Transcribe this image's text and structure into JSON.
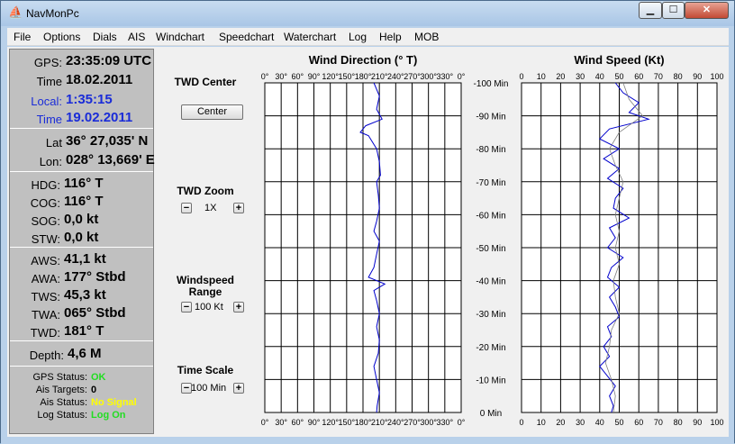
{
  "window": {
    "title": "NavMonPc",
    "app_icon": "⛵",
    "min_label": "▁",
    "max_label": "☐",
    "close_label": "✕"
  },
  "menu": [
    "File",
    "Options",
    "Dials",
    "AIS",
    "Windchart",
    "Speedchart",
    "Waterchart",
    "Log",
    "Help",
    "MOB"
  ],
  "instruments": {
    "time": [
      {
        "label": "GPS:",
        "value": "23:35:09 UTC"
      },
      {
        "label": "Time",
        "value": "18.02.2011"
      },
      {
        "label": "Local:",
        "value": "1:35:15"
      },
      {
        "label": "Time",
        "value": "19.02.2011"
      }
    ],
    "position": [
      {
        "label": "Lat",
        "value": "36° 27,035' N"
      },
      {
        "label": "Lon:",
        "value": "028° 13,669' E"
      }
    ],
    "heading": [
      {
        "label": "HDG:",
        "value": "116° T"
      },
      {
        "label": "COG:",
        "value": "116° T"
      },
      {
        "label": "SOG:",
        "value": "0,0 kt"
      },
      {
        "label": "STW:",
        "value": "0,0 kt"
      }
    ],
    "wind": [
      {
        "label": "AWS:",
        "value": "41,1 kt"
      },
      {
        "label": "AWA:",
        "value": "177° Stbd"
      },
      {
        "label": "TWS:",
        "value": "45,3 kt"
      },
      {
        "label": "TWA:",
        "value": "065° Stbd"
      },
      {
        "label": "TWD:",
        "value": "181° T"
      }
    ],
    "depth": {
      "label": "Depth:",
      "value": "4,6 M"
    },
    "status": [
      {
        "label": "GPS Status:",
        "value": "OK",
        "color": "#22dd22"
      },
      {
        "label": "Ais Targets:",
        "value": "0",
        "color": "#000000"
      },
      {
        "label": "Ais Status:",
        "value": "No Signal",
        "color": "#ffff00"
      },
      {
        "label": "Log Status:",
        "value": "Log On",
        "color": "#22dd22"
      }
    ]
  },
  "controls": {
    "twd_center_label": "TWD Center",
    "center_button": "Center",
    "twd_zoom_label": "TWD Zoom",
    "twd_zoom_value": "1X",
    "windspeed_range_label": "Windspeed Range",
    "windspeed_range_value": "100 Kt",
    "time_scale_label": "Time Scale",
    "time_scale_value": "100 Min",
    "minus": "−",
    "plus": "+"
  },
  "chart_data": [
    {
      "type": "line",
      "title": "Wind Direction (° T)",
      "x_ticks": [
        "0°",
        "30°",
        "60°",
        "90°",
        "120°",
        "150°",
        "180°",
        "210°",
        "240°",
        "270°",
        "300°",
        "330°",
        "0°"
      ],
      "xlim": [
        0,
        360
      ],
      "ylim": [
        -100,
        0
      ],
      "y_ticks": [
        "-100 Min",
        "-90 Min",
        "-80 Min",
        "-70 Min",
        "-60 Min",
        "-50 Min",
        "-40 Min",
        "-30 Min",
        "-20 Min",
        "-10 Min",
        "0 Min"
      ],
      "grid": true,
      "series": [
        {
          "color": "#0000cc",
          "t": [
            -100,
            -96,
            -92,
            -89,
            -87,
            -85,
            -84,
            -80,
            -76,
            -72,
            -70,
            -66,
            -62,
            -58,
            -55,
            -52,
            -48,
            -44,
            -41,
            -39,
            -37,
            -34,
            -30,
            -26,
            -22,
            -18,
            -14,
            -10,
            -6,
            -2,
            0
          ],
          "v": [
            200,
            210,
            205,
            215,
            185,
            175,
            190,
            205,
            210,
            212,
            205,
            208,
            210,
            205,
            200,
            210,
            205,
            200,
            190,
            220,
            200,
            205,
            210,
            205,
            210,
            208,
            200,
            205,
            210,
            206,
            205
          ]
        }
      ]
    },
    {
      "type": "line",
      "title": "Wind Speed (Kt)",
      "x_ticks": [
        "0",
        "10",
        "20",
        "30",
        "40",
        "50",
        "60",
        "70",
        "80",
        "90",
        "100"
      ],
      "xlim": [
        0,
        100
      ],
      "ylim": [
        -100,
        0
      ],
      "grid": true,
      "series": [
        {
          "color": "#0000cc",
          "t": [
            -100,
            -97,
            -94,
            -91,
            -89,
            -86,
            -83,
            -80,
            -77,
            -74,
            -71,
            -68,
            -65,
            -62,
            -59,
            -56,
            -53,
            -50,
            -47,
            -44,
            -41,
            -38,
            -35,
            -32,
            -29,
            -26,
            -23,
            -20,
            -17,
            -14,
            -11,
            -8,
            -5,
            -2,
            0
          ],
          "v": [
            48,
            52,
            60,
            55,
            65,
            45,
            40,
            50,
            42,
            50,
            44,
            52,
            48,
            47,
            55,
            45,
            48,
            44,
            52,
            46,
            44,
            50,
            45,
            48,
            50,
            44,
            46,
            42,
            45,
            40,
            44,
            48,
            45,
            47,
            46
          ]
        },
        {
          "color": "#808080",
          "t": [
            -100,
            -95,
            -90,
            -85,
            -80,
            -75,
            -70,
            -65,
            -60,
            -55,
            -50,
            -45,
            -40,
            -35,
            -30,
            -25,
            -20,
            -15,
            -10,
            -5,
            0
          ],
          "v": [
            52,
            55,
            62,
            50,
            45,
            48,
            52,
            50,
            48,
            50,
            48,
            50,
            47,
            48,
            50,
            46,
            45,
            43,
            46,
            48,
            47
          ]
        }
      ]
    }
  ]
}
